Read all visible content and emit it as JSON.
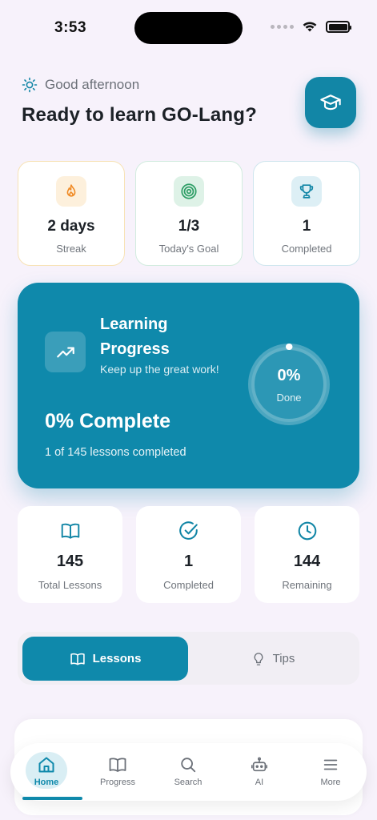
{
  "status_bar": {
    "time": "3:53"
  },
  "header": {
    "greeting": "Good afternoon",
    "title": "Ready to learn GO-Lang?"
  },
  "stats": {
    "streak": {
      "value": "2 days",
      "label": "Streak"
    },
    "goal": {
      "value": "1/3",
      "label": "Today's Goal"
    },
    "completed": {
      "value": "1",
      "label": "Completed"
    }
  },
  "progress_card": {
    "title": "Learning Progress",
    "subtitle": "Keep up the great work!",
    "percent_label": "0% Complete",
    "count_label": "1 of 145 lessons completed",
    "ring_value": "0%",
    "ring_label": "Done",
    "progress_fraction": 0
  },
  "lesson_stats": {
    "total": {
      "value": "145",
      "label": "Total Lessons"
    },
    "completed": {
      "value": "1",
      "label": "Completed"
    },
    "remaining": {
      "value": "144",
      "label": "Remaining"
    }
  },
  "segment": {
    "lessons_label": "Lessons",
    "tips_label": "Tips",
    "selected": "Lessons"
  },
  "tab_bar": {
    "home": "Home",
    "progress": "Progress",
    "search": "Search",
    "ai": "AI",
    "more": "More",
    "active": "Home"
  },
  "colors": {
    "accent": "#0f89ab",
    "background": "#f7f2fb",
    "streak": "#f08a24",
    "goal": "#2e9e66"
  }
}
